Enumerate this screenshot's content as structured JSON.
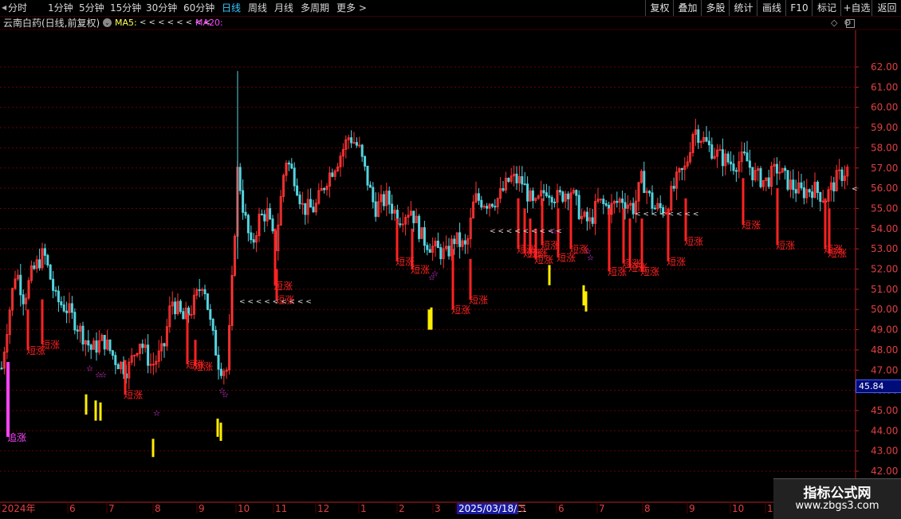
{
  "toolbar": {
    "periods": [
      "分时",
      "1分钟",
      "5分钟",
      "15分钟",
      "30分钟",
      "60分钟",
      "日线",
      "周线",
      "月线",
      "多周期",
      "更多 >"
    ],
    "active_period": "日线",
    "right_buttons": [
      "复权",
      "叠加",
      "多股",
      "统计",
      "画线",
      "F10",
      "标记",
      "+自选",
      "返回"
    ]
  },
  "infobar": {
    "title": "云南白药(日线,前复权)",
    "ma5_label": "MA5:",
    "ma5_value": "< < < < < < < <",
    "ma20_label": "MA20:"
  },
  "price_box": "45.84",
  "colors": {
    "up": "#ff3333",
    "down": "#54d4e0",
    "signal": "#ff2222",
    "yellow": "#ffee00",
    "pink": "#ff44ff",
    "grid": "#6a0000",
    "axis": "#b02020"
  },
  "chart_data": {
    "type": "candlestick",
    "y_ticks": [
      "62.00",
      "61.00",
      "60.00",
      "59.00",
      "58.00",
      "57.00",
      "56.00",
      "55.00",
      "54.00",
      "53.00",
      "52.00",
      "51.00",
      "50.00",
      "49.00",
      "48.00",
      "47.00",
      "46.00",
      "45.00",
      "44.00",
      "43.00",
      "42.00"
    ],
    "ylim": [
      41.8,
      63.0
    ],
    "x_labels": [
      "2024年",
      "6",
      "7",
      "8",
      "9",
      "10",
      "11",
      "12",
      "1",
      "2",
      "3",
      "2025/03/18/二",
      "5",
      "6",
      "7",
      "8",
      "9",
      "10",
      "11"
    ],
    "labels_text": {
      "short": "短涨",
      "chase": "追涨"
    },
    "price_path": [
      [
        0,
        46.5
      ],
      [
        10,
        49.5
      ],
      [
        20,
        52.0
      ],
      [
        30,
        50.5
      ],
      [
        40,
        51.8
      ],
      [
        55,
        52.8
      ],
      [
        70,
        50.5
      ],
      [
        85,
        50.0
      ],
      [
        100,
        49.0
      ],
      [
        115,
        48.0
      ],
      [
        130,
        48.5
      ],
      [
        145,
        47.5
      ],
      [
        160,
        47.0
      ],
      [
        175,
        48.5
      ],
      [
        190,
        47.2
      ],
      [
        205,
        48.0
      ],
      [
        215,
        50.5
      ],
      [
        230,
        49.5
      ],
      [
        240,
        50.0
      ],
      [
        255,
        51.5
      ],
      [
        265,
        49.0
      ],
      [
        275,
        47.2
      ],
      [
        285,
        47.0
      ],
      [
        292,
        52.0
      ],
      [
        298,
        57.0
      ],
      [
        305,
        55.0
      ],
      [
        315,
        53.0
      ],
      [
        325,
        54.5
      ],
      [
        335,
        54.8
      ],
      [
        345,
        53.0
      ],
      [
        358,
        57.5
      ],
      [
        370,
        56.5
      ],
      [
        380,
        55.0
      ],
      [
        395,
        55.0
      ],
      [
        410,
        56.5
      ],
      [
        425,
        57.5
      ],
      [
        438,
        58.6
      ],
      [
        450,
        58.0
      ],
      [
        460,
        56.5
      ],
      [
        470,
        55.0
      ],
      [
        485,
        55.5
      ],
      [
        500,
        54.5
      ],
      [
        515,
        55.0
      ],
      [
        530,
        53.5
      ],
      [
        545,
        53.0
      ],
      [
        560,
        52.7
      ],
      [
        570,
        53.5
      ],
      [
        585,
        53.0
      ],
      [
        595,
        55.5
      ],
      [
        610,
        55.3
      ],
      [
        625,
        55.5
      ],
      [
        640,
        56.5
      ],
      [
        655,
        56.3
      ],
      [
        670,
        55.0
      ],
      [
        685,
        56.0
      ],
      [
        700,
        55.5
      ],
      [
        715,
        56.0
      ],
      [
        730,
        54.5
      ],
      [
        740,
        54.3
      ],
      [
        750,
        55.3
      ],
      [
        765,
        55.0
      ],
      [
        780,
        55.5
      ],
      [
        795,
        55.0
      ],
      [
        805,
        56.5
      ],
      [
        820,
        55.0
      ],
      [
        835,
        55.0
      ],
      [
        850,
        56.5
      ],
      [
        860,
        57.0
      ],
      [
        870,
        59.0
      ],
      [
        880,
        58.5
      ],
      [
        890,
        58.0
      ],
      [
        905,
        57.5
      ],
      [
        920,
        57.2
      ],
      [
        935,
        57.5
      ],
      [
        945,
        56.7
      ],
      [
        960,
        56.3
      ],
      [
        975,
        57.0
      ],
      [
        990,
        56.2
      ],
      [
        1005,
        55.8
      ],
      [
        1020,
        56.0
      ],
      [
        1035,
        55.5
      ],
      [
        1050,
        56.5
      ],
      [
        1065,
        57.0
      ]
    ],
    "red_signals": [
      [
        35,
        48.0,
        50.0
      ],
      [
        53,
        48.3,
        50.5
      ],
      [
        157,
        45.8,
        47.5
      ],
      [
        235,
        47.3,
        49.8
      ],
      [
        245,
        47.2,
        48.5
      ],
      [
        345,
        51.2,
        54.0
      ],
      [
        347,
        50.5,
        52.0
      ],
      [
        498,
        52.4,
        54.5
      ],
      [
        517,
        52.0,
        54.0
      ],
      [
        568,
        50.0,
        53.0
      ],
      [
        590,
        50.5,
        52.5
      ],
      [
        650,
        53.0,
        55.5
      ],
      [
        658,
        52.8,
        55.0
      ],
      [
        665,
        52.8,
        54.5
      ],
      [
        672,
        52.5,
        54.0
      ],
      [
        680,
        53.2,
        55.5
      ],
      [
        700,
        52.6,
        55.0
      ],
      [
        716,
        53.0,
        55.5
      ],
      [
        764,
        51.9,
        55.0
      ],
      [
        782,
        52.3,
        55.0
      ],
      [
        790,
        52.1,
        54.5
      ],
      [
        805,
        51.9,
        54.5
      ],
      [
        838,
        52.4,
        55.0
      ],
      [
        860,
        53.4,
        55.5
      ],
      [
        932,
        54.2,
        56.5
      ],
      [
        975,
        53.2,
        56.0
      ],
      [
        1035,
        53.0,
        55.5
      ],
      [
        1040,
        52.8,
        55.0
      ]
    ],
    "pink_candle": [
      10,
      43.7,
      47.4
    ],
    "yellow_bars": [
      [
        108,
        44.8,
        45.8
      ],
      [
        120,
        44.5,
        45.5
      ],
      [
        126,
        44.5,
        45.4
      ],
      [
        192,
        42.7,
        43.6
      ],
      [
        273,
        43.7,
        44.6
      ],
      [
        277,
        43.5,
        44.4
      ],
      [
        538,
        49.0,
        50.0
      ],
      [
        541,
        49.0,
        50.1
      ],
      [
        689,
        51.2,
        52.2
      ],
      [
        732,
        50.2,
        51.2
      ],
      [
        735,
        49.9,
        50.9
      ]
    ],
    "stars": [
      [
        113,
        47.1
      ],
      [
        124,
        46.8
      ],
      [
        130,
        46.8
      ],
      [
        197,
        44.9
      ],
      [
        279,
        46.0
      ],
      [
        283,
        45.8
      ],
      [
        542,
        51.6
      ],
      [
        546,
        51.8
      ],
      [
        695,
        53.9
      ],
      [
        738,
        52.9
      ],
      [
        741,
        52.6
      ]
    ],
    "arrow_groups": [
      [
        300,
        50.4,
        9
      ],
      [
        614,
        53.9,
        9
      ],
      [
        796,
        54.75,
        8
      ]
    ],
    "marker_right": [
      1068,
      55.98
    ]
  }
}
